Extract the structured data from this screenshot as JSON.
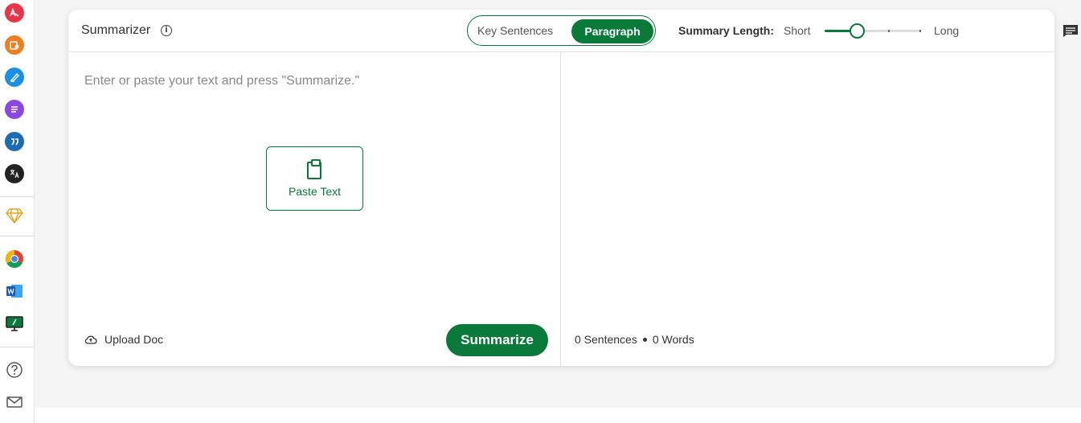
{
  "app": {
    "title": "Summarizer",
    "info_icon": "info-icon"
  },
  "mode_toggle": {
    "options": [
      "Key Sentences",
      "Paragraph"
    ],
    "selected": "Paragraph"
  },
  "summary_length": {
    "label": "Summary Length:",
    "min_label": "Short",
    "max_label": "Long",
    "value_fraction": 0.33
  },
  "input": {
    "placeholder": "Enter or paste your text and press \"Summarize.\"",
    "paste_label": "Paste Text",
    "upload_label": "Upload Doc",
    "summarize_label": "Summarize"
  },
  "output": {
    "sentences": "0 Sentences",
    "words": "0 Words"
  },
  "rail": {
    "icons": [
      "paraphraser-icon",
      "grammar-icon",
      "cowriter-icon",
      "summarizer-icon",
      "citation-icon",
      "translate-icon",
      "premium-icon",
      "chrome-icon",
      "word-icon",
      "desktop-icon",
      "help-icon",
      "mail-icon"
    ]
  },
  "colors": {
    "accent": "#0a7a3b",
    "background": "#f5f5f5"
  }
}
